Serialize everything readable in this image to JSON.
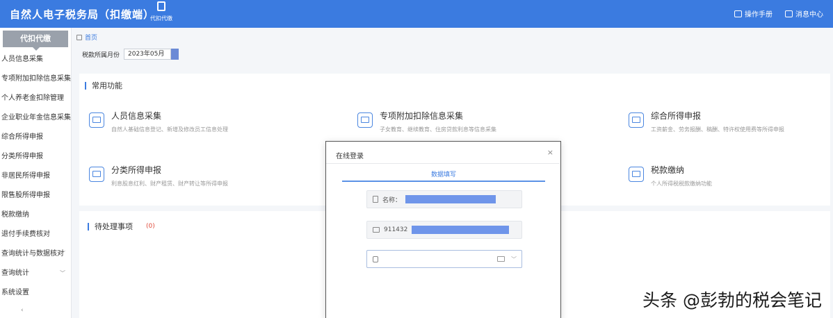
{
  "header": {
    "title": "自然人电子税务局（扣缴端）",
    "home_label": "代扣代缴",
    "actions": [
      {
        "label": "操作手册",
        "icon": "book-icon"
      },
      {
        "label": "消息中心",
        "icon": "mail-icon"
      }
    ]
  },
  "sidebar": {
    "head": "代扣代缴",
    "items": [
      {
        "label": "人员信息采集",
        "has_children": false
      },
      {
        "label": "专项附加扣除信息采集",
        "has_children": false
      },
      {
        "label": "个人养老金扣除管理",
        "has_children": false
      },
      {
        "label": "企业职业年金信息采集",
        "has_children": false
      },
      {
        "label": "综合所得申报",
        "has_children": false
      },
      {
        "label": "分类所得申报",
        "has_children": false
      },
      {
        "label": "非居民所得申报",
        "has_children": false
      },
      {
        "label": "限售股所得申报",
        "has_children": false
      },
      {
        "label": "税款缴纳",
        "has_children": false
      },
      {
        "label": "退付手续费核对",
        "has_children": false
      },
      {
        "label": "查询统计与数据核对",
        "has_children": true
      },
      {
        "label": "查询统计",
        "has_children": true
      },
      {
        "label": "系统设置",
        "has_children": false
      }
    ],
    "collapse": "‹"
  },
  "breadcrumb": "首页",
  "period": {
    "label": "税款所属月份",
    "value": "2023年05月"
  },
  "common_functions": {
    "title": "常用功能",
    "items": [
      {
        "title": "人员信息采集",
        "desc": "自然人基础信息登记、新增及修改员工信息处理"
      },
      {
        "title": "专项附加扣除信息采集",
        "desc": "子女教育、继续教育、住房贷款利息等信息采集"
      },
      {
        "title": "综合所得申报",
        "desc": "工资薪金、劳务报酬、稿酬、特许权使用费等所得申报"
      },
      {
        "title": "分类所得申报",
        "desc": "利息股息红利、财产租赁、财产转让等所得申报"
      },
      {
        "title": "税款缴纳",
        "desc": "个人所得税税款缴纳功能"
      }
    ]
  },
  "todo": {
    "title": "待处理事项",
    "badge": "(0)"
  },
  "modal": {
    "title": "在线登录",
    "close": "×",
    "tab": "数据填写",
    "fields": [
      {
        "prefix": "名称：",
        "masked": true
      },
      {
        "prefix": "911432",
        "masked": true
      }
    ],
    "password_placeholder": ""
  },
  "watermark": "头条 @彭勃的税会笔记"
}
